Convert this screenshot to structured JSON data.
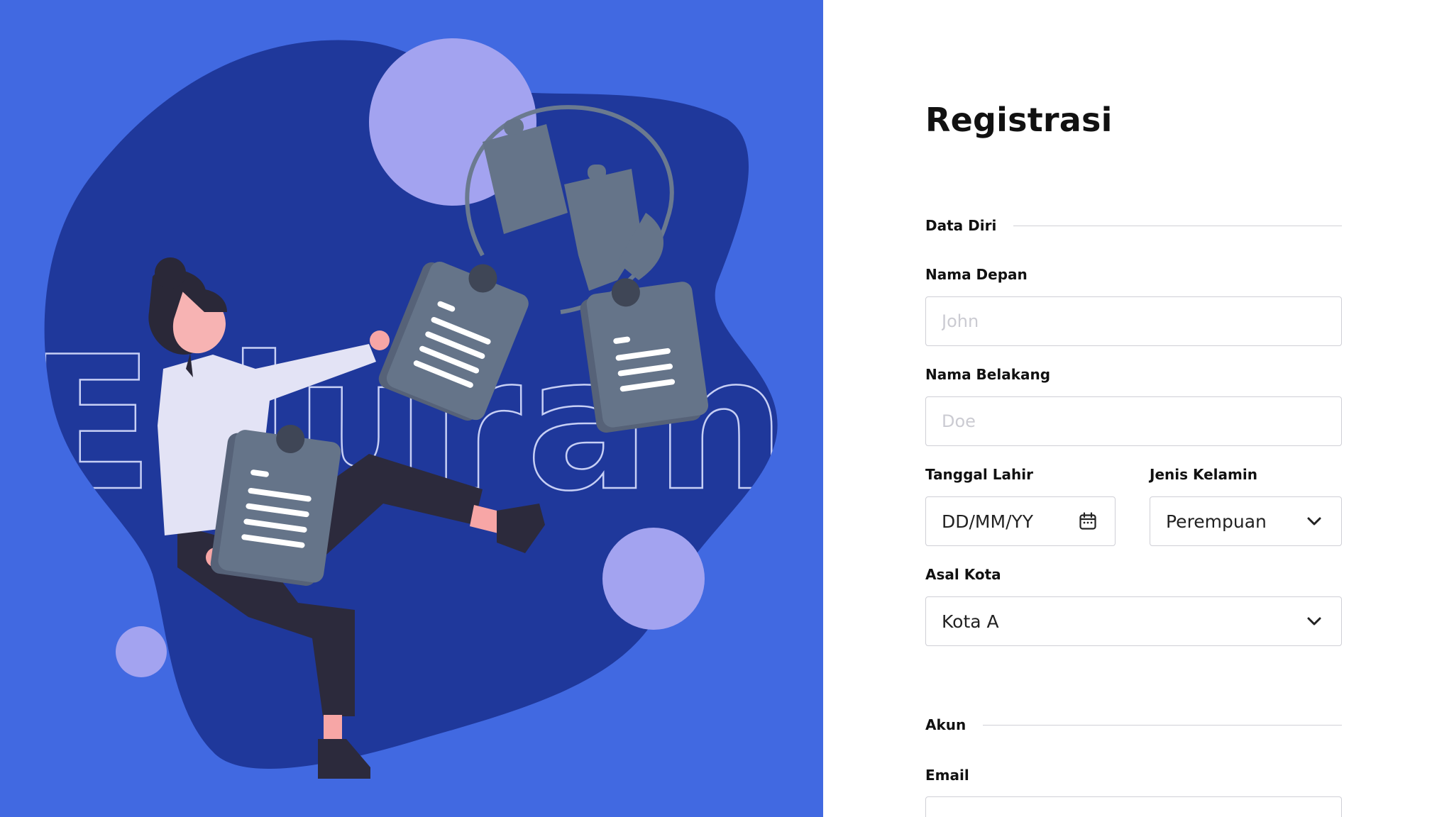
{
  "illustration": {
    "watermark_text": "Eduran",
    "background_color": "#4169e1",
    "blob_color": "#1f389b",
    "accent_circle_color": "#a3a3f0"
  },
  "form": {
    "title": "Registrasi",
    "sections": {
      "personal": {
        "label": "Data Diri"
      },
      "account": {
        "label": "Akun"
      }
    },
    "first_name": {
      "label": "Nama Depan",
      "placeholder": "John",
      "value": ""
    },
    "last_name": {
      "label": "Nama Belakang",
      "placeholder": "Doe",
      "value": ""
    },
    "birth_date": {
      "label": "Tanggal Lahir",
      "value": "DD/MM/YY",
      "icon": "calendar-icon"
    },
    "gender": {
      "label": "Jenis Kelamin",
      "value": "Perempuan",
      "icon": "chevron-down-icon"
    },
    "city": {
      "label": "Asal Kota",
      "value": "Kota A",
      "icon": "chevron-down-icon"
    },
    "email": {
      "label": "Email",
      "placeholder": "",
      "value": ""
    }
  }
}
